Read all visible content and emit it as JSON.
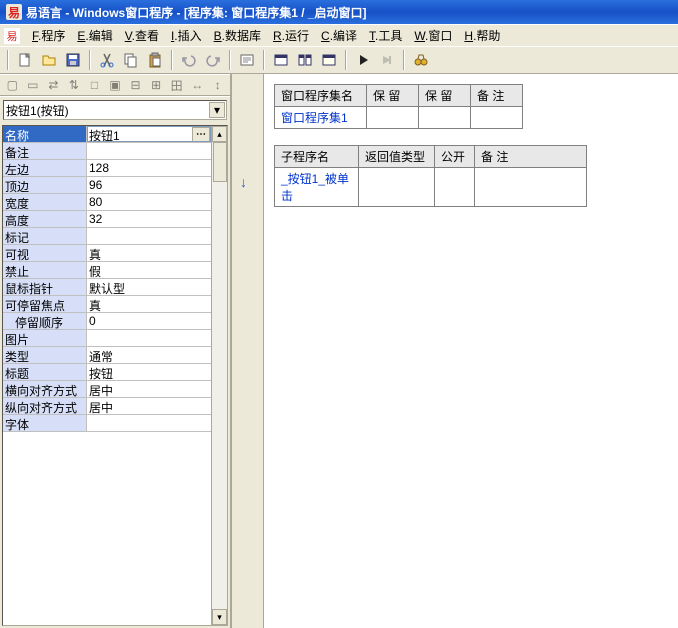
{
  "title": "易语言 - Windows窗口程序 - [程序集: 窗口程序集1 / _启动窗口]",
  "app_icon": "易",
  "menubar": {
    "items": [
      {
        "hot": "F",
        "label": ".程序"
      },
      {
        "hot": "E",
        "label": ".编辑"
      },
      {
        "hot": "V",
        "label": ".查看"
      },
      {
        "hot": "I",
        "label": ".插入"
      },
      {
        "hot": "B",
        "label": ".数据库"
      },
      {
        "hot": "R",
        "label": ".运行"
      },
      {
        "hot": "C",
        "label": ".编译"
      },
      {
        "hot": "T",
        "label": ".工具"
      },
      {
        "hot": "W",
        "label": ".窗口"
      },
      {
        "hot": "H",
        "label": ".帮助"
      }
    ]
  },
  "toolbar_icons": [
    "new",
    "open",
    "save",
    "cut",
    "copy",
    "paste",
    "undo",
    "redo",
    "find",
    "panel1",
    "panel2",
    "window",
    "run",
    "pause",
    "binoc"
  ],
  "left_toolbar": [
    "a",
    "b",
    "c",
    "d",
    "e",
    "f",
    "g",
    "h",
    "i",
    "j",
    "k"
  ],
  "prop_combo": "按钮1(按钮)",
  "properties": [
    {
      "label": "名称",
      "value": "按钮1",
      "selected": true,
      "edit": true
    },
    {
      "label": "备注",
      "value": ""
    },
    {
      "label": "左边",
      "value": "128"
    },
    {
      "label": "顶边",
      "value": "96"
    },
    {
      "label": "宽度",
      "value": "80"
    },
    {
      "label": "高度",
      "value": "32"
    },
    {
      "label": "标记",
      "value": ""
    },
    {
      "label": "可视",
      "value": "真"
    },
    {
      "label": "禁止",
      "value": "假"
    },
    {
      "label": "鼠标指针",
      "value": "默认型"
    },
    {
      "label": "可停留焦点",
      "value": "真"
    },
    {
      "label": "停留顺序",
      "value": "0",
      "indent": true
    },
    {
      "label": "图片",
      "value": ""
    },
    {
      "label": "类型",
      "value": "通常"
    },
    {
      "label": "标题",
      "value": "按钮"
    },
    {
      "label": "横向对齐方式",
      "value": "居中"
    },
    {
      "label": "纵向对齐方式",
      "value": "居中"
    },
    {
      "label": "字体",
      "value": ""
    }
  ],
  "table1": {
    "headers": [
      "窗口程序集名",
      "保 留",
      "保 留",
      "备 注"
    ],
    "row": [
      "窗口程序集1",
      "",
      "",
      ""
    ]
  },
  "table2": {
    "headers": [
      "子程序名",
      "返回值类型",
      "公开",
      "备 注"
    ],
    "row": [
      "_按钮1_被单击",
      "",
      "",
      ""
    ]
  },
  "gutter_arrow": "↓",
  "colors": {
    "title_bg": "#1651c7",
    "prop_label_bg": "#d6dff7",
    "sel_bg": "#316ac5",
    "link": "#0033cc"
  }
}
